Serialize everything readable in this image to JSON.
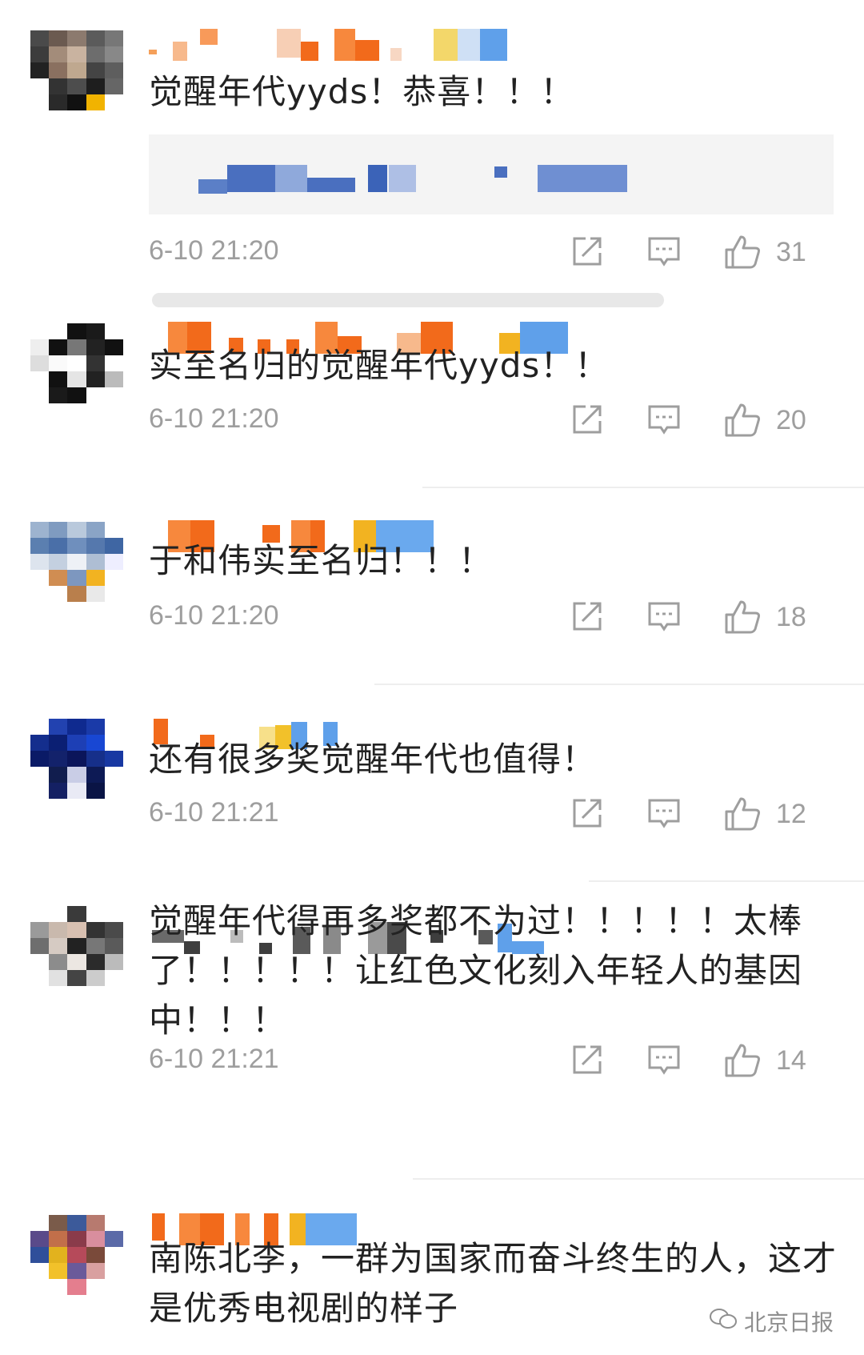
{
  "comments": [
    {
      "text": "觉醒年代yyds！恭喜！！！",
      "time": "6-10 21:20",
      "likes": "31"
    },
    {
      "text": "实至名归的觉醒年代yyds！！",
      "time": "6-10 21:20",
      "likes": "20"
    },
    {
      "text": "于和伟实至名归！！！",
      "time": "6-10 21:20",
      "likes": "18"
    },
    {
      "text": "还有很多奖觉醒年代也值得！",
      "time": "6-10 21:21",
      "likes": "12"
    },
    {
      "text": "觉醒年代得再多奖都不为过！！！！！太棒了！！！！！让红色文化刻入年轻人的基因中！！！",
      "time": "6-10 21:21",
      "likes": "14"
    },
    {
      "text": "南陈北李，一群为国家而奋斗终生的人，这才是优秀电视剧的样子"
    }
  ],
  "icons": {
    "share": "share-icon",
    "reply": "comment-icon",
    "like": "thumbs-up-icon"
  },
  "watermark": {
    "text": "北京日报",
    "icon": "wechat-icon"
  },
  "colors": {
    "text": "#222222",
    "meta": "#9e9e9e",
    "divider": "#eeeeee",
    "reply_bg": "#f4f4f4"
  }
}
